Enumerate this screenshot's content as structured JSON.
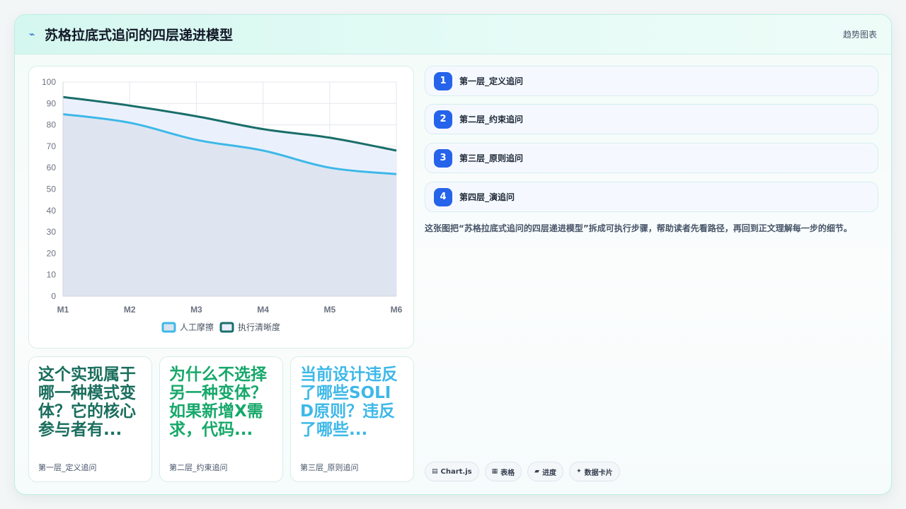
{
  "header": {
    "title": "苏格拉底式追问的四层递进模型",
    "logo_icon": "spark-icon",
    "tag": "趋势图表"
  },
  "chart_data": {
    "type": "area",
    "categories": [
      "M1",
      "M2",
      "M3",
      "M4",
      "M5",
      "M6"
    ],
    "ylim": [
      0,
      100
    ],
    "yticks": [
      0,
      10,
      20,
      30,
      40,
      50,
      60,
      70,
      80,
      90,
      100
    ],
    "grid": true,
    "legend_position": "bottom",
    "series": [
      {
        "name": "人工摩擦",
        "values": [
          85,
          81,
          73,
          68,
          60,
          57
        ],
        "color": "#3db8e8",
        "fill": "#dce3ef"
      },
      {
        "name": "执行清晰度",
        "values": [
          93,
          89,
          84,
          78,
          74,
          68
        ],
        "color": "#1a6e6a",
        "fill": "#e8eefc"
      }
    ]
  },
  "steps": [
    {
      "num": "1",
      "label": "第一层_定义追问"
    },
    {
      "num": "2",
      "label": "第二层_约束追问"
    },
    {
      "num": "3",
      "label": "第三层_原则追问"
    },
    {
      "num": "4",
      "label": "第四层_演追问"
    }
  ],
  "description": "这张图把“苏格拉底式追问的四层递进模型”拆成可执行步骤，帮助读者先看路径，再回到正文理解每一步的细节。",
  "questions": [
    {
      "text": "这个实现属于哪一种模式变体？它的核心参与者有...",
      "sub": "第一层_定义追问",
      "color": "#1a6e5e"
    },
    {
      "text": "为什么不选择另一种变体？如果新增X需求，代码...",
      "sub": "第二层_约束追问",
      "color": "#16a86a"
    },
    {
      "text": "当前设计违反了哪些SOLID原则？违反了哪些...",
      "sub": "第三层_原则追问",
      "color": "#3db8e8"
    }
  ],
  "chips": [
    {
      "icon": "▤",
      "label": "Chart.js"
    },
    {
      "icon": "▦",
      "label": "表格"
    },
    {
      "icon": "▰",
      "label": "进度"
    },
    {
      "icon": "✦",
      "label": "数据卡片"
    }
  ]
}
